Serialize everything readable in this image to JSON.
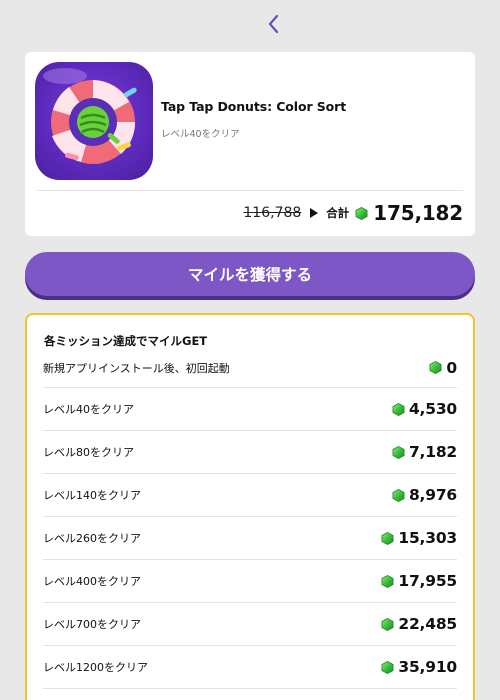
{
  "app": {
    "title": "Tap Tap Donuts: Color Sort",
    "subtitle": "レベル40をクリア",
    "icon": "donut-app-icon"
  },
  "price": {
    "old": "116,788",
    "total_label": "合計",
    "total": "175,182"
  },
  "cta_label": "マイルを獲得する",
  "missions": {
    "heading": "各ミッション達成でマイルGET",
    "items": [
      {
        "label": "新規アプリインストール後、初回起動",
        "value": "0"
      },
      {
        "label": "レベル40をクリア",
        "value": "4,530"
      },
      {
        "label": "レベル80をクリア",
        "value": "7,182"
      },
      {
        "label": "レベル140をクリア",
        "value": "8,976"
      },
      {
        "label": "レベル260をクリア",
        "value": "15,303"
      },
      {
        "label": "レベル400をクリア",
        "value": "17,955"
      },
      {
        "label": "レベル700をクリア",
        "value": "22,485"
      },
      {
        "label": "レベル1200をクリア",
        "value": "35,910"
      }
    ]
  },
  "colors": {
    "accent": "#7e57c6",
    "accent_shadow": "#4a2f86",
    "mission_border": "#f3c12c",
    "gem": "#3bbf3b"
  }
}
